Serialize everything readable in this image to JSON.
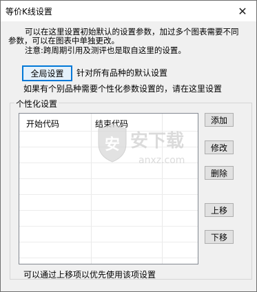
{
  "window": {
    "title": "等价K线设置",
    "close_glyph": "✕"
  },
  "desc": {
    "line1": "可以在这里设置初始默认的设置参数，加过多个图表需要不同",
    "line2": "参数，可以在图表中单独更改。",
    "line3": "注意:跨周期引用及测评也是取自这里的设置。"
  },
  "global": {
    "button_label": "全局设置",
    "description": "针对所有品种的默认设置",
    "hint": "如果有个别品种需要个性化参数设置的，请在这里设置"
  },
  "personal": {
    "group_label": "个性化设置",
    "columns": [
      "开始代码",
      "结束代码"
    ],
    "rows": [],
    "buttons": {
      "add": "添加",
      "edit": "修改",
      "delete": "删除",
      "up": "上移",
      "down": "下移"
    },
    "footer": "可以通过上移项以优先使用该项设置"
  },
  "watermark": {
    "text": "安下载",
    "sub": "anxz.com"
  }
}
